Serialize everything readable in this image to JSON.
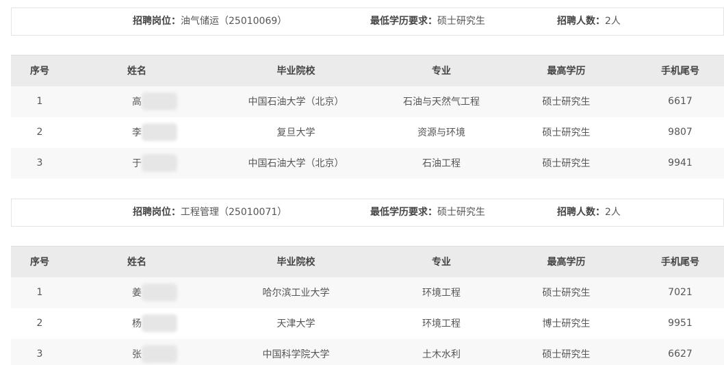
{
  "sections": [
    {
      "position_label": "招聘岗位：",
      "position_value": "油气储运（25010069）",
      "edu_label": "最低学历要求：",
      "edu_value": "硕士研究生",
      "count_label": "招聘人数：",
      "count_value": "2人",
      "headers": [
        "序号",
        "姓名",
        "毕业院校",
        "专业",
        "最高学历",
        "手机尾号"
      ],
      "rows": [
        {
          "no": "1",
          "name": "高",
          "school": "中国石油大学（北京）",
          "major": "石油与天然气工程",
          "degree": "硕士研究生",
          "phone": "6617"
        },
        {
          "no": "2",
          "name": "李",
          "school": "复旦大学",
          "major": "资源与环境",
          "degree": "硕士研究生",
          "phone": "9807"
        },
        {
          "no": "3",
          "name": "于",
          "school": "中国石油大学（北京）",
          "major": "石油工程",
          "degree": "硕士研究生",
          "phone": "9941"
        }
      ]
    },
    {
      "position_label": "招聘岗位：",
      "position_value": "工程管理（25010071）",
      "edu_label": "最低学历要求：",
      "edu_value": "硕士研究生",
      "count_label": "招聘人数：",
      "count_value": "2人",
      "headers": [
        "序号",
        "姓名",
        "毕业院校",
        "专业",
        "最高学历",
        "手机尾号"
      ],
      "rows": [
        {
          "no": "1",
          "name": "姜",
          "school": "哈尔滨工业大学",
          "major": "环境工程",
          "degree": "硕士研究生",
          "phone": "7021"
        },
        {
          "no": "2",
          "name": "杨",
          "school": "天津大学",
          "major": "环境工程",
          "degree": "博士研究生",
          "phone": "9951"
        },
        {
          "no": "3",
          "name": "张",
          "school": "中国科学院大学",
          "major": "土木水利",
          "degree": "硕士研究生",
          "phone": "6627"
        }
      ]
    }
  ]
}
